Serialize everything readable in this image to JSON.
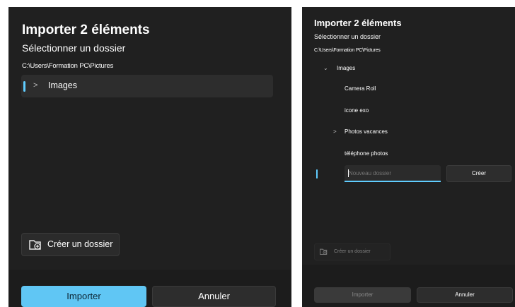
{
  "left": {
    "title": "Importer 2 éléments",
    "subtitle": "Sélectionner un dossier",
    "path": "C:\\Users\\Formation PC\\Pictures",
    "tree": [
      {
        "label": "Images",
        "expanded": false
      }
    ],
    "new_folder_label": "Créer un dossier",
    "import_label": "Importer",
    "cancel_label": "Annuler"
  },
  "right": {
    "title": "Importer 2 éléments",
    "subtitle": "Sélectionner un dossier",
    "path": "C:\\Users\\Formation PC\\Pictures",
    "tree": {
      "root": "Images",
      "children": [
        "Camera Roll",
        "icone exo",
        "Photos vacances",
        "téléphone photos"
      ]
    },
    "new_folder_placeholder": "Nouveau dossier",
    "create_label": "Créer",
    "new_folder_label": "Créer un dossier",
    "import_label": "Importer",
    "cancel_label": "Annuler"
  },
  "colors": {
    "background": "#202020",
    "accent": "#60cdff",
    "primary_button": "#60c6f4"
  },
  "icons": [
    "chevron-right-icon",
    "chevron-down-icon",
    "new-folder-icon"
  ]
}
